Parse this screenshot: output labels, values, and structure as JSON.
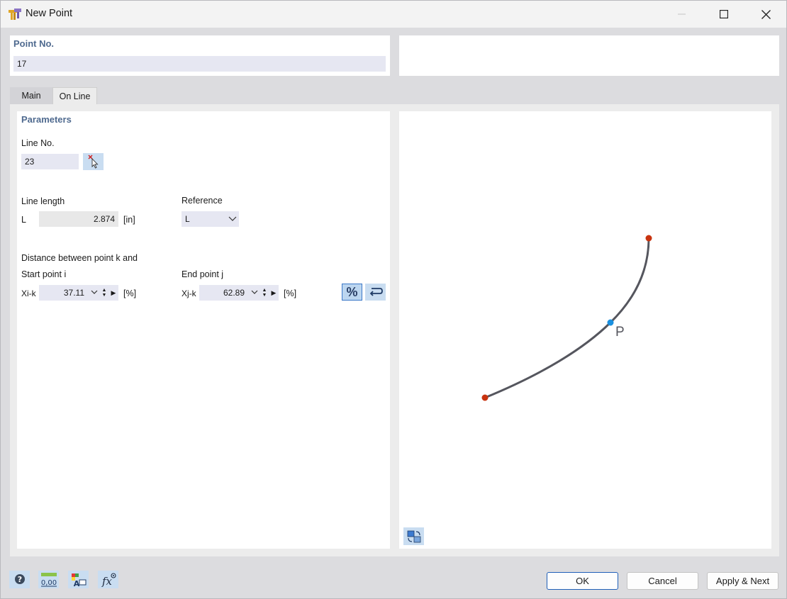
{
  "window": {
    "title": "New Point"
  },
  "point_no": {
    "label": "Point No.",
    "value": "17"
  },
  "tabs": [
    {
      "label": "Main"
    },
    {
      "label": "On Line"
    }
  ],
  "parameters": {
    "heading": "Parameters",
    "line_no_label": "Line No.",
    "line_no_value": "23",
    "line_length_label": "Line length",
    "length_symbol": "L",
    "length_value": "2.874",
    "length_unit": "[in]",
    "reference_label": "Reference",
    "reference_value": "L",
    "distance_label": "Distance between point k and",
    "start_label": "Start point i",
    "start_symbol": "Xi-k",
    "start_value": "37.11",
    "start_unit": "[%]",
    "end_label": "End point j",
    "end_symbol": "Xj-k",
    "end_value": "62.89",
    "end_unit": "[%]",
    "percent_button": "%"
  },
  "preview": {
    "point_label": "P"
  },
  "footer": {
    "ok": "OK",
    "cancel": "Cancel",
    "apply_next": "Apply & Next"
  }
}
